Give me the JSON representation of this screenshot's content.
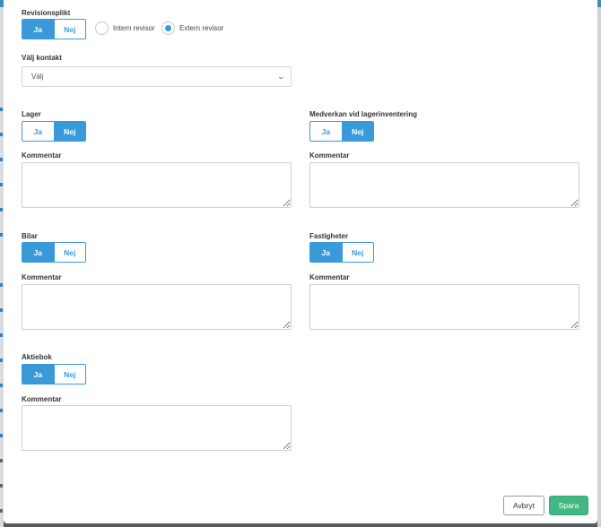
{
  "revision": {
    "label": "Revisionsplikt",
    "yes": "Ja",
    "no": "Nej",
    "selected": "Ja",
    "auditor_options": [
      "Intern revisor",
      "Extern revisor"
    ],
    "auditor_selected": "Extern revisor"
  },
  "contact": {
    "label": "Välj kontakt",
    "value": "Välj"
  },
  "lager": {
    "label": "Lager",
    "yes": "Ja",
    "no": "Nej",
    "selected": "Nej",
    "comment_label": "Kommentar"
  },
  "inventering": {
    "label": "Medverkan vid lagerinventering",
    "yes": "Ja",
    "no": "Nej",
    "selected": "Nej",
    "comment_label": "Kommentar"
  },
  "bilar": {
    "label": "Bilar",
    "yes": "Ja",
    "no": "Nej",
    "selected": "Ja",
    "comment_label": "Kommentar"
  },
  "fastigheter": {
    "label": "Fastigheter",
    "yes": "Ja",
    "no": "Nej",
    "selected": "Ja",
    "comment_label": "Kommentar"
  },
  "aktiebok": {
    "label": "Aktiebok",
    "yes": "Ja",
    "no": "Nej",
    "selected": "Ja",
    "comment_label": "Kommentar"
  },
  "footer": {
    "cancel": "Avbryt",
    "save": "Spara"
  },
  "colors": {
    "accent": "#3a9ad9",
    "save": "#41b883"
  }
}
